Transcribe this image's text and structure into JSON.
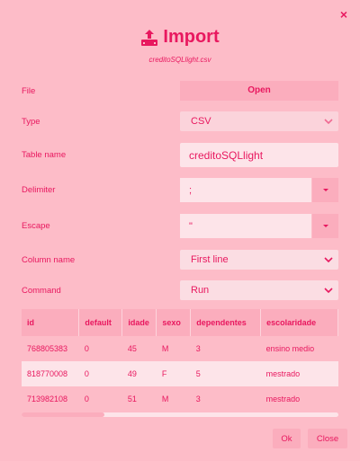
{
  "dialog": {
    "title": "Import",
    "filename": "creditoSQLlight.csv",
    "close_glyph": "×"
  },
  "fields": {
    "file": {
      "label": "File",
      "button": "Open"
    },
    "type": {
      "label": "Type",
      "value": "CSV"
    },
    "table_name": {
      "label": "Table name",
      "value": "creditoSQLlight"
    },
    "delimiter": {
      "label": "Delimiter",
      "value": ";"
    },
    "escape": {
      "label": "Escape",
      "value": "\""
    },
    "column_name": {
      "label": "Column name",
      "value": "First line"
    },
    "command": {
      "label": "Command",
      "value": "Run"
    }
  },
  "preview": {
    "columns": [
      "id",
      "default",
      "idade",
      "sexo",
      "dependentes",
      "escolaridade"
    ],
    "rows": [
      [
        "768805383",
        "0",
        "45",
        "M",
        "3",
        "ensino medio"
      ],
      [
        "818770008",
        "0",
        "49",
        "F",
        "5",
        "mestrado"
      ],
      [
        "713982108",
        "0",
        "51",
        "M",
        "3",
        "mestrado"
      ]
    ]
  },
  "footer": {
    "ok": "Ok",
    "close": "Close"
  },
  "colors": {
    "accent": "#e8185f",
    "background": "#fdbcc8",
    "button": "#fbadbd",
    "field": "#fde4e9"
  },
  "icons": {
    "title_icon": "upload-icon",
    "chevron": "chevron-down-icon",
    "close": "close-icon"
  }
}
